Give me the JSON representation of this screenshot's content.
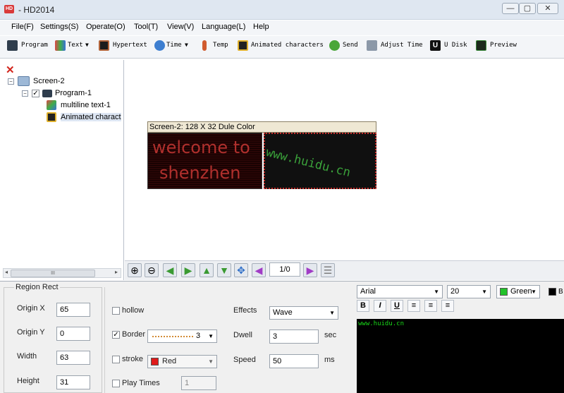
{
  "window": {
    "title": "- HD2014",
    "icon_label": "HD",
    "min": "—",
    "max": "▢",
    "close": "✕"
  },
  "menu": [
    "File(F)",
    "Settings(S)",
    "Operate(O)",
    "Tool(T)",
    "View(V)",
    "Language(L)",
    "Help"
  ],
  "toolbar": {
    "program": "Program",
    "text": "Text",
    "hypertext": "Hypertext",
    "time": "Time",
    "temp": "Temp",
    "animated": "Animated characters",
    "send": "Send",
    "adjust_time": "Adjust Time",
    "udisk": "U Disk",
    "preview": "Preview"
  },
  "tree": {
    "screen": "Screen-2",
    "program": "Program-1",
    "item1": "multiline text-1",
    "item2": "Animated charact",
    "scroll_label": "III"
  },
  "screen": {
    "header": "Screen-2: 128 X 32 Dule Color",
    "led_text_line1": "welcome to",
    "led_text_line2": "shenzhen",
    "led_scroll_text": "www.huidu.cn"
  },
  "nav": {
    "page": "1/0"
  },
  "region": {
    "title": "Region Rect",
    "origin_x_label": "Origin X",
    "origin_x": "65",
    "origin_y_label": "Origin Y",
    "origin_y": "0",
    "width_label": "Width",
    "width": "63",
    "height_label": "Height",
    "height": "31"
  },
  "options": {
    "hollow": "hollow",
    "border": "Border",
    "border_value": "3",
    "stroke": "stroke",
    "stroke_color": "Red",
    "play_times": "Play Times",
    "play_times_value": "1"
  },
  "effects": {
    "effects_label": "Effects",
    "effects_value": "Wave",
    "dwell_label": "Dwell",
    "dwell_value": "3",
    "dwell_unit": "sec",
    "speed_label": "Speed",
    "speed_value": "50",
    "speed_unit": "ms"
  },
  "font": {
    "family": "Arial",
    "size": "20",
    "color": "Green",
    "bold": "B",
    "italic": "I",
    "underline": "U",
    "extra": "B"
  },
  "preview_text": "www.huidu.cn",
  "colors": {
    "led_red": "#b0302d",
    "led_green": "#3aa13a",
    "accent_red": "#d2241b"
  }
}
